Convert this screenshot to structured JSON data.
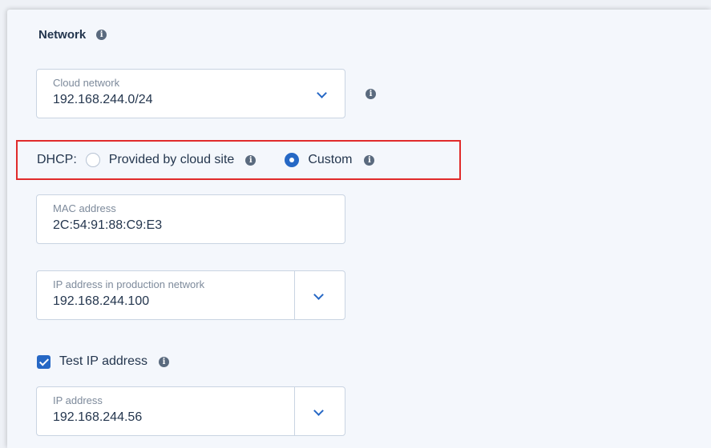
{
  "network": {
    "title": "Network",
    "cloud_network": {
      "label": "Cloud network",
      "value": "192.168.244.0/24"
    },
    "dhcp": {
      "label": "DHCP:",
      "options": [
        {
          "label": "Provided by cloud site",
          "selected": false
        },
        {
          "label": "Custom",
          "selected": true
        }
      ]
    },
    "mac_address": {
      "label": "MAC address",
      "value": "2C:54:91:88:C9:E3"
    },
    "production_ip": {
      "label": "IP address in production network",
      "value": "192.168.244.100"
    },
    "test_ip": {
      "checkbox_label": "Test IP address",
      "checked": true,
      "label": "IP address",
      "value": "192.168.244.56"
    }
  },
  "icons": {
    "info": "info-icon",
    "chevron": "chevron-down-icon",
    "radio": "radio-icon",
    "checkbox": "checkbox-icon"
  },
  "colors": {
    "accent": "#2668c5",
    "highlight_border": "#e02b2b",
    "text": "#24364e",
    "muted_text": "#7d8a9b",
    "field_border": "#c9d4e2"
  }
}
